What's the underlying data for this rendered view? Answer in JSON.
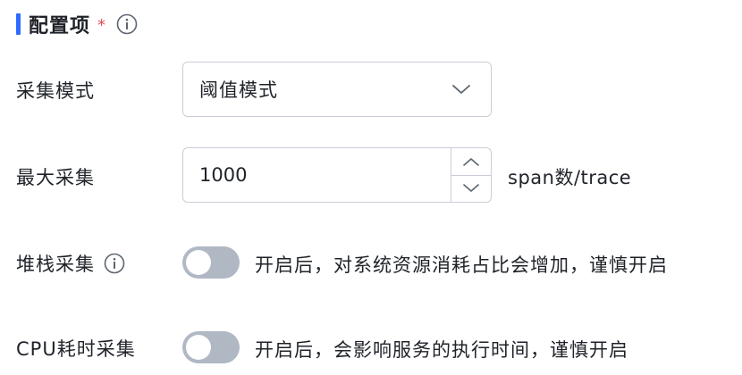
{
  "section": {
    "title": "配置项",
    "required_mark": "*"
  },
  "fields": {
    "collect_mode": {
      "label": "采集模式",
      "selected": "阈值模式"
    },
    "max_collect": {
      "label": "最大采集",
      "value": "1000",
      "unit": "span数/trace"
    },
    "stack_collect": {
      "label": "堆栈采集",
      "enabled": false,
      "hint": "开启后，对系统资源消耗占比会增加，谨慎开启"
    },
    "cpu_time_collect": {
      "label": "CPU耗时采集",
      "enabled": false,
      "hint": "开启后，会影响服务的执行时间，谨慎开启"
    }
  },
  "colors": {
    "accent": "#2f6bff",
    "required": "#e34d59",
    "toggle_off": "#b0b8c4",
    "border": "#c9ced6"
  }
}
